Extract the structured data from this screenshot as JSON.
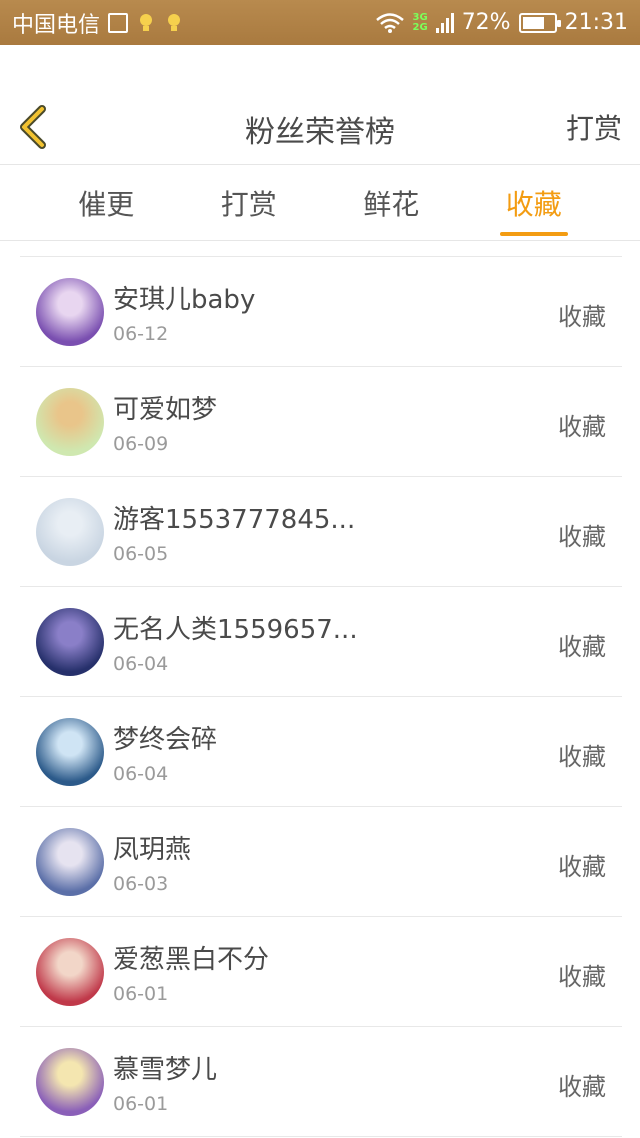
{
  "status_bar": {
    "carrier": "中国电信",
    "net_3g": "3G",
    "net_2g": "2G",
    "battery": "72%",
    "time": "21:31",
    "battery_level": 0.72
  },
  "header": {
    "title": "粉丝荣誉榜",
    "right_action": "打赏"
  },
  "tabs": [
    "催更",
    "打赏",
    "鲜花",
    "收藏"
  ],
  "active_tab": 3,
  "accent_color": "#f39c12",
  "list": [
    {
      "name": "安琪儿baby",
      "date": "06-12",
      "action": "收藏",
      "avatar_colors": [
        "#7a4fb0",
        "#e8d6f0"
      ]
    },
    {
      "name": "可爱如梦",
      "date": "06-09",
      "action": "收藏",
      "avatar_colors": [
        "#cfe8b0",
        "#e9c58a"
      ]
    },
    {
      "name": "游客1553777845...",
      "date": "06-05",
      "action": "收藏",
      "avatar_colors": [
        "#c9d5e2",
        "#e8eef4"
      ]
    },
    {
      "name": "无名人类1559657...",
      "date": "06-04",
      "action": "收藏",
      "avatar_colors": [
        "#26306b",
        "#8a7fc8"
      ]
    },
    {
      "name": "梦终会碎",
      "date": "06-04",
      "action": "收藏",
      "avatar_colors": [
        "#2c5a8a",
        "#cfe4f4"
      ]
    },
    {
      "name": "凤玥燕",
      "date": "06-03",
      "action": "收藏",
      "avatar_colors": [
        "#5b6fa8",
        "#e6e3f0"
      ]
    },
    {
      "name": "爱葱黑白不分",
      "date": "06-01",
      "action": "收藏",
      "avatar_colors": [
        "#c0394a",
        "#f2d6c8"
      ]
    },
    {
      "name": "慕雪梦儿",
      "date": "06-01",
      "action": "收藏",
      "avatar_colors": [
        "#8a5fb8",
        "#f4e6b0"
      ]
    }
  ]
}
